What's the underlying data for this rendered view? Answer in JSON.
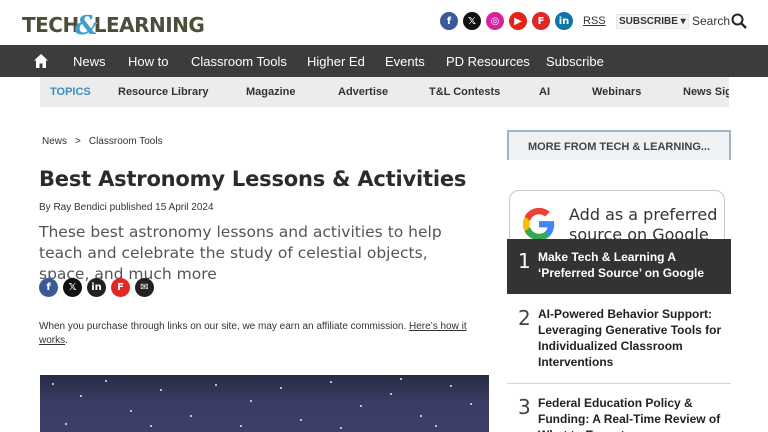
{
  "header": {
    "logo_left": "TECH",
    "logo_amp": "&",
    "logo_right": "LEARNING",
    "social": [
      {
        "name": "facebook-icon",
        "glyph": "f",
        "color": "#3b5998"
      },
      {
        "name": "x-icon",
        "glyph": "𝕏",
        "color": "#111111"
      },
      {
        "name": "instagram-icon",
        "glyph": "◎",
        "color": "#d6249f"
      },
      {
        "name": "youtube-icon",
        "glyph": "▶",
        "color": "#e62117"
      },
      {
        "name": "flipboard-icon",
        "glyph": "F",
        "color": "#e12828"
      },
      {
        "name": "linkedin-icon",
        "glyph": "in",
        "color": "#0e76a8"
      }
    ],
    "rss": "RSS",
    "subscribe": "SUBSCRIBE ▾",
    "search": "Search"
  },
  "nav": {
    "items": [
      "News",
      "How to",
      "Classroom Tools",
      "Higher Ed",
      "Events",
      "PD Resources",
      "Subscribe"
    ]
  },
  "topics": {
    "items": [
      "TOPICS",
      "Resource Library",
      "Magazine",
      "Advertise",
      "T&L Contests",
      "AI",
      "Webinars",
      "News Sig"
    ]
  },
  "article": {
    "breadcrumb": [
      "News",
      ">",
      "Classroom Tools"
    ],
    "title": "Best Astronomy Lessons & Activities",
    "byline": "By Ray Bendici published 15 April 2024",
    "standfirst": "These best astronomy lessons and activities to help teach and celebrate the study of celestial objects, space, and much more",
    "share": [
      {
        "name": "share-facebook-icon",
        "glyph": "f",
        "color": "#3b5998"
      },
      {
        "name": "share-x-icon",
        "glyph": "𝕏",
        "color": "#111111"
      },
      {
        "name": "share-linkedin-icon",
        "glyph": "in",
        "color": "#222222"
      },
      {
        "name": "share-flipboard-icon",
        "glyph": "F",
        "color": "#e12828"
      },
      {
        "name": "share-email-icon",
        "glyph": "✉",
        "color": "#222222"
      }
    ],
    "affiliate_text": "When you purchase through links on our site, we may earn an affiliate commission. ",
    "affiliate_link": "Here’s how it works",
    "affiliate_end": "."
  },
  "sidebar": {
    "more_title": "MORE FROM TECH & LEARNING...",
    "google_line1": "Add as a preferred",
    "google_line2": "source on Google",
    "items": [
      {
        "num": "1",
        "text": "Make Tech & Learning A ‘Preferred Source’ on Google"
      },
      {
        "num": "2",
        "text": "AI-Powered Behavior Support: Leveraging Generative Tools for Individualized Classroom Interventions"
      },
      {
        "num": "3",
        "text": "Federal Education Policy & Funding: A Real-Time Review of What to Expect"
      }
    ]
  }
}
